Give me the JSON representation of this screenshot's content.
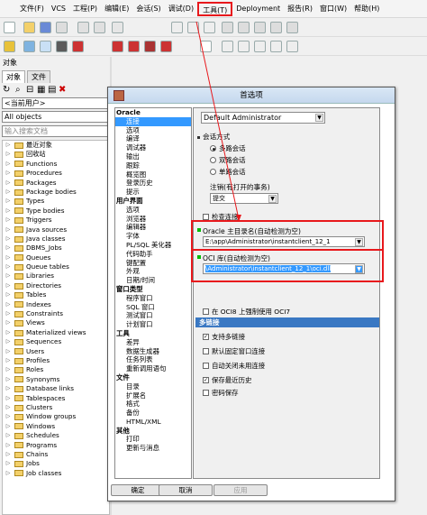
{
  "menubar": {
    "items": [
      "文件(F)",
      "VCS",
      "工程(P)",
      "编辑(E)",
      "会话(S)",
      "调试(D)",
      "工具(T)",
      "Deployment",
      "报告(R)",
      "窗口(W)",
      "帮助(H)"
    ]
  },
  "object_panel": {
    "header": "对象",
    "tabs": [
      "对象",
      "文件"
    ],
    "user_combo": "<当前用户>",
    "objects_combo": "All objects",
    "search_placeholder": "输入搜索文档",
    "tree": [
      "最近对象",
      "回收站",
      "Functions",
      "Procedures",
      "Packages",
      "Package bodies",
      "Types",
      "Type bodies",
      "Triggers",
      "Java sources",
      "Java classes",
      "DBMS_Jobs",
      "Queues",
      "Queue tables",
      "Libraries",
      "Directories",
      "Tables",
      "Indexes",
      "Constraints",
      "Views",
      "Materialized views",
      "Sequences",
      "Users",
      "Profiles",
      "Roles",
      "Synonyms",
      "Database links",
      "Tablespaces",
      "Clusters",
      "Window groups",
      "Windows",
      "Schedules",
      "Programs",
      "Chains",
      "Jobs",
      "Job classes"
    ]
  },
  "dialog": {
    "title": "首选项",
    "categories": [
      {
        "name": "Oracle",
        "items": [
          "连接",
          "选项",
          "编译",
          "调试器",
          "输出",
          "跟踪",
          "概览图",
          "登录历史",
          "提示"
        ]
      },
      {
        "name": "用户界面",
        "items": [
          "选项",
          "浏览器",
          "编辑器",
          "字体",
          "PL/SQL 美化器",
          "代码助手",
          "键配置",
          "外观",
          "日期/时间"
        ]
      },
      {
        "name": "窗口类型",
        "items": [
          "程序窗口",
          "SQL 窗口",
          "测试窗口",
          "计划窗口"
        ]
      },
      {
        "name": "工具",
        "items": [
          "差异",
          "数据生成器",
          "任务列表",
          "重新调用语句"
        ]
      },
      {
        "name": "文件",
        "items": [
          "目录",
          "扩展名",
          "格式",
          "备份",
          "HTML/XML"
        ]
      },
      {
        "name": "其他",
        "items": [
          "打印",
          "更新与消息"
        ]
      }
    ],
    "selected_category_item": "连接",
    "settings_combo": "Default Administrator",
    "session_mode": {
      "title": "会话方式",
      "options": [
        "多路会话",
        "双路会话",
        "单路会话"
      ],
      "selected": "多路会话"
    },
    "logoff": {
      "title": "注销(有打开的事务)",
      "value": "提交"
    },
    "check_connection_label": "检查连接",
    "oracle_home": {
      "label": "Oracle 主目录名(自动检测为空)",
      "value": "E:\\app\\Administrator\\instantclient_12_1"
    },
    "oci_library": {
      "label": "OCI 库(自动检测为空)",
      "value": "\\Administrator\\instantclient_12_1\\oci.dll"
    },
    "oci7_label": "在 OCI8 上强制使用 OCI7",
    "multi_connection": {
      "title": "多链接",
      "options": [
        {
          "label": "支持多链接",
          "checked": true
        },
        {
          "label": "默认固定窗口连接",
          "checked": false
        },
        {
          "label": "自动关闭未用连接",
          "checked": false
        },
        {
          "label": "保存最近历史",
          "checked": true
        },
        {
          "label": "密码保存",
          "checked": false
        }
      ]
    },
    "buttons": {
      "ok": "确定",
      "cancel": "取消",
      "apply": "应用"
    }
  },
  "colors": {
    "highlight_red": "#e8181c",
    "selection_blue": "#3399ff",
    "section_blue": "#3a78c3"
  }
}
